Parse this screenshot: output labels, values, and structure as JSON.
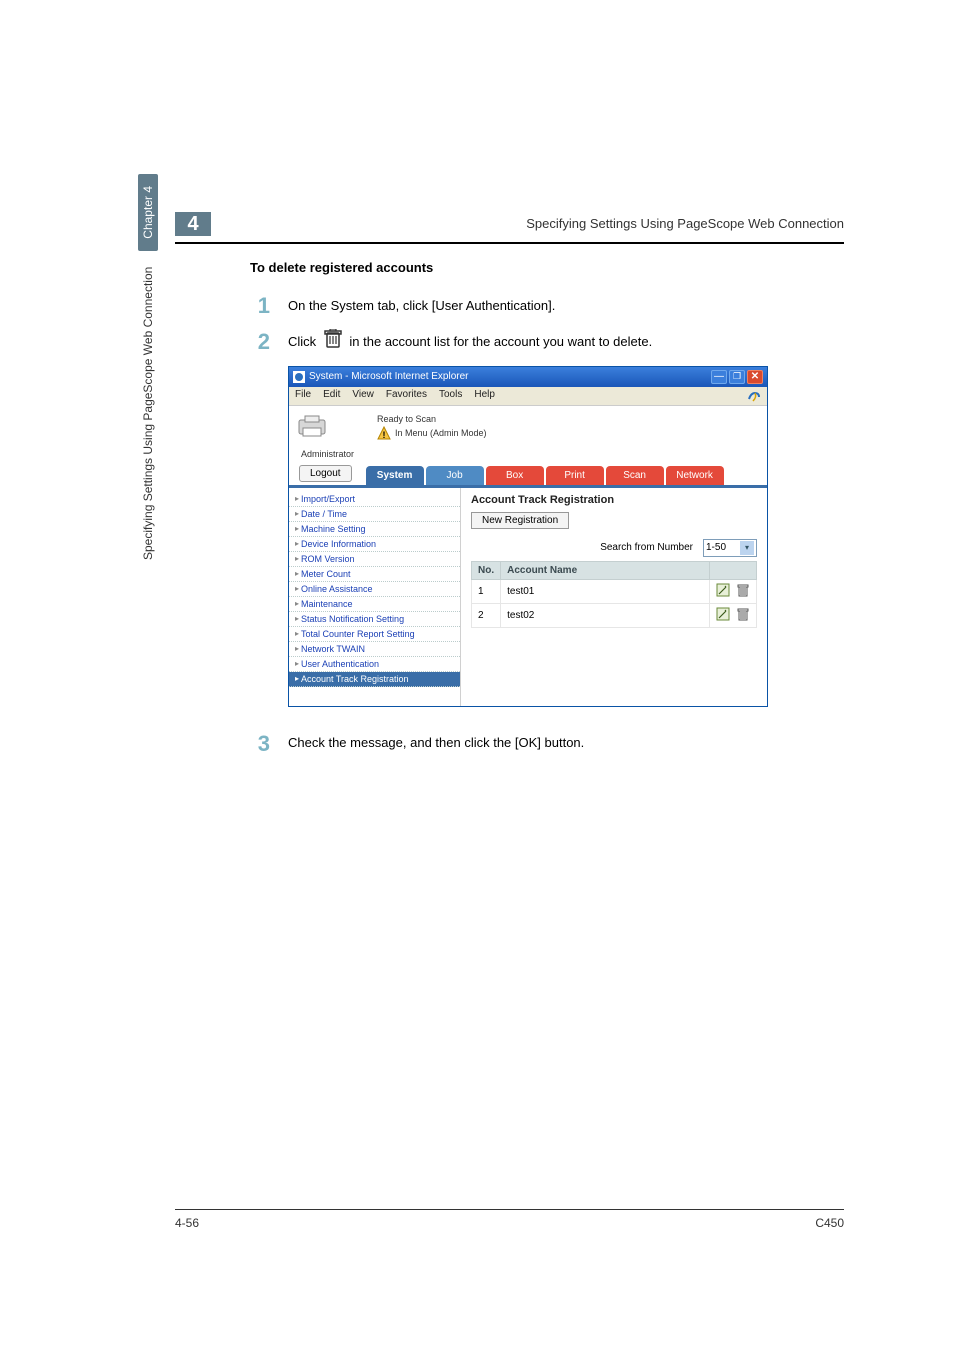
{
  "header": {
    "chapter_number": "4",
    "running_title": "Specifying Settings Using PageScope Web Connection"
  },
  "section_heading": "To delete registered accounts",
  "steps": {
    "s1": {
      "num": "1",
      "text": "On the System tab, click [User Authentication]."
    },
    "s2": {
      "num": "2",
      "pre": "Click ",
      "post": " in the account list for the account you want to delete."
    },
    "s3": {
      "num": "3",
      "text": "Check the message, and then click the [OK] button."
    }
  },
  "window": {
    "title": "System - Microsoft Internet Explorer",
    "menus": [
      "File",
      "Edit",
      "View",
      "Favorites",
      "Tools",
      "Help"
    ],
    "status": {
      "line1": "Ready to Scan",
      "line2": "In Menu (Admin Mode)"
    },
    "admin_label": "Administrator",
    "logout_label": "Logout",
    "tabs": {
      "system": "System",
      "job": "Job",
      "box": "Box",
      "print": "Print",
      "scan": "Scan",
      "network": "Network"
    },
    "sidebar": [
      "Import/Export",
      "Date / Time",
      "Machine Setting",
      "Device Information",
      "ROM Version",
      "Meter Count",
      "Online Assistance",
      "Maintenance",
      "Status Notification Setting",
      "Total Counter Report Setting",
      "Network TWAIN",
      "User Authentication",
      "Account Track Registration"
    ],
    "pane": {
      "title": "Account Track Registration",
      "new_registration": "New Registration",
      "search_label": "Search from Number",
      "search_value": "1-50",
      "columns": {
        "no": "No.",
        "name": "Account Name"
      },
      "rows": [
        {
          "no": "1",
          "name": "test01"
        },
        {
          "no": "2",
          "name": "test02"
        }
      ]
    }
  },
  "side_vertical": {
    "long": "Specifying Settings Using PageScope Web Connection",
    "pill": "Chapter 4"
  },
  "footer": {
    "page": "4-56",
    "model": "C450"
  }
}
